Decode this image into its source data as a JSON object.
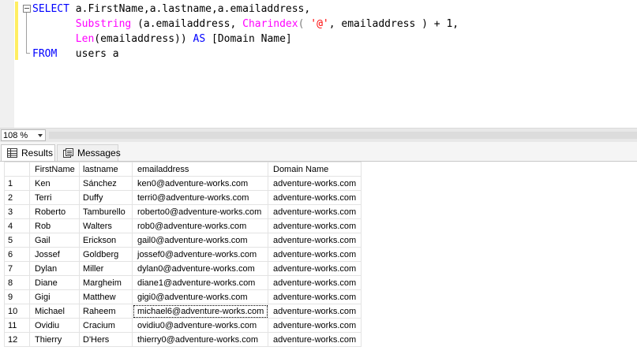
{
  "editor": {
    "line1": {
      "kw_select": "SELECT",
      "cols": "a.FirstName,a.lastname,a.emailaddress,"
    },
    "line2": {
      "indent": "       ",
      "fn_substring": "Substring",
      "p1": " (a.emailaddress, ",
      "fn_charindex": "Charindex",
      "p2": "( ",
      "str_at": "'@'",
      "p3": ", emailaddress ) + 1,"
    },
    "line3": {
      "indent": "       ",
      "fn_len": "Len",
      "p1": "(emailaddress)) ",
      "kw_as": "AS",
      "alias": " [Domain Name]"
    },
    "line4": {
      "kw_from": "FROM",
      "rest": "   users a"
    }
  },
  "zoom": {
    "value": "108 %"
  },
  "tabs": {
    "results": "Results",
    "messages": "Messages"
  },
  "grid": {
    "headers": [
      "",
      "FirstName",
      "lastname",
      "emailaddress",
      "Domain Name"
    ],
    "rows": [
      [
        "1",
        "Ken",
        "Sánchez",
        "ken0@adventure-works.com",
        "adventure-works.com"
      ],
      [
        "2",
        "Terri",
        "Duffy",
        "terri0@adventure-works.com",
        "adventure-works.com"
      ],
      [
        "3",
        "Roberto",
        "Tamburello",
        "roberto0@adventure-works.com",
        "adventure-works.com"
      ],
      [
        "4",
        "Rob",
        "Walters",
        "rob0@adventure-works.com",
        "adventure-works.com"
      ],
      [
        "5",
        "Gail",
        "Erickson",
        "gail0@adventure-works.com",
        "adventure-works.com"
      ],
      [
        "6",
        "Jossef",
        "Goldberg",
        "jossef0@adventure-works.com",
        "adventure-works.com"
      ],
      [
        "7",
        "Dylan",
        "Miller",
        "dylan0@adventure-works.com",
        "adventure-works.com"
      ],
      [
        "8",
        "Diane",
        "Margheim",
        "diane1@adventure-works.com",
        "adventure-works.com"
      ],
      [
        "9",
        "Gigi",
        "Matthew",
        "gigi0@adventure-works.com",
        "adventure-works.com"
      ],
      [
        "10",
        "Michael",
        "Raheem",
        "michael6@adventure-works.com",
        "adventure-works.com"
      ],
      [
        "11",
        "Ovidiu",
        "Cracium",
        "ovidiu0@adventure-works.com",
        "adventure-works.com"
      ],
      [
        "12",
        "Thierry",
        "D'Hers",
        "thierry0@adventure-works.com",
        "adventure-works.com"
      ]
    ],
    "selected_row": 9,
    "selected_col": 3
  },
  "colors": {
    "keyword": "#0000ff",
    "function": "#ff00ff",
    "string": "#ff0000",
    "gutter_change": "#ffee62"
  }
}
